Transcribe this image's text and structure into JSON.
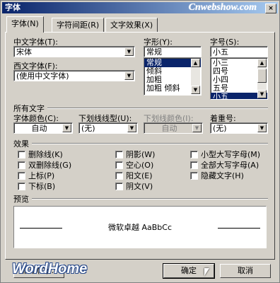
{
  "window": {
    "title": "字体",
    "watermark_top": "Cnwebshow.com",
    "close_label": "×"
  },
  "tabs": [
    {
      "label": "字体(N)",
      "active": true
    },
    {
      "label": "字符间距(R)",
      "active": false
    },
    {
      "label": "文字效果(X)",
      "active": false
    }
  ],
  "font": {
    "chinese_label": "中文字体(T):",
    "chinese_value": "宋体",
    "western_label": "西文字体(F):",
    "western_value": "(使用中文字体)",
    "style_label": "字形(Y):",
    "style_value": "常规",
    "style_options": [
      "常规",
      "倾斜",
      "加粗",
      "加粗 倾斜"
    ],
    "size_label": "字号(S):",
    "size_value": "小五",
    "size_options": [
      "小三",
      "四号",
      "小四",
      "五号",
      "小五"
    ]
  },
  "all_text": {
    "section_label": "所有文字",
    "color_label": "字体颜色(C):",
    "color_value": "自动",
    "underline_label": "下划线线型(U):",
    "underline_value": "(无)",
    "underline_color_label": "下划线颜色(I):",
    "underline_color_value": "自动",
    "emphasis_label": "着重号:",
    "emphasis_value": "(无)"
  },
  "effects": {
    "section_label": "效果",
    "col1": [
      "删除线(K)",
      "双删除线(G)",
      "上标(P)",
      "下标(B)"
    ],
    "col2": [
      "阴影(W)",
      "空心(O)",
      "阳文(E)",
      "阴文(V)"
    ],
    "col3": [
      "小型大写字母(M)",
      "全部大写字母(A)",
      "隐藏文字(H)"
    ]
  },
  "preview": {
    "label": "预览",
    "sample": "微软卓越  AaBbCc"
  },
  "buttons": {
    "default_label": "默认(D)...",
    "ok_label": "确定",
    "cancel_label": "取消"
  },
  "watermark_bottom": "WordHome"
}
